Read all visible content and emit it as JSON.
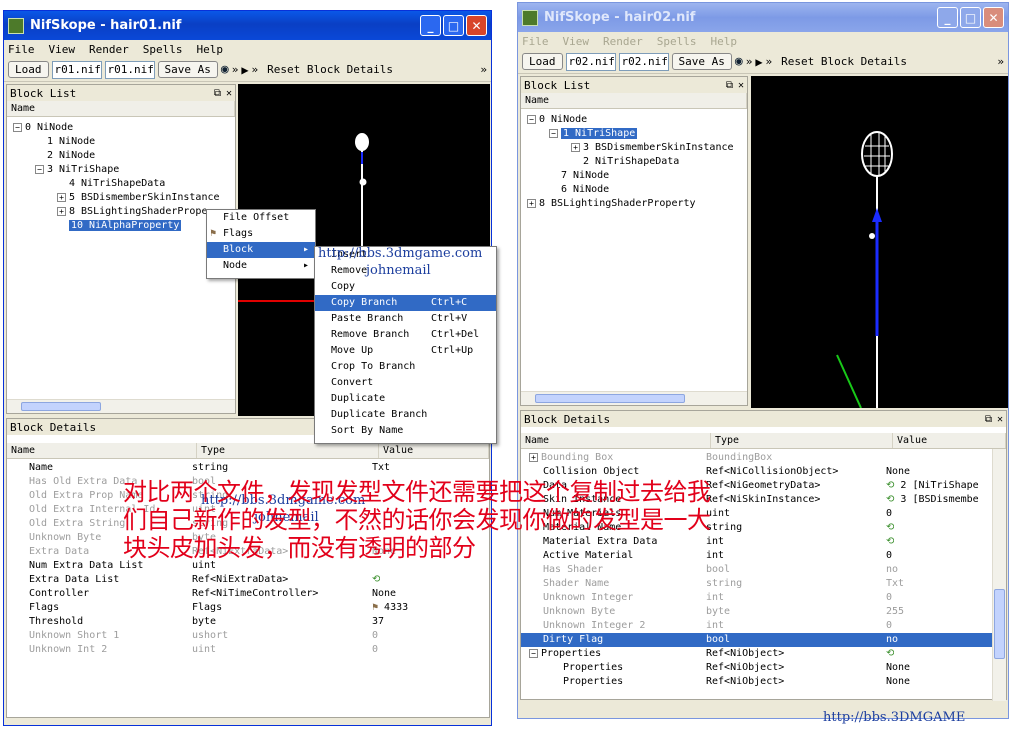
{
  "left_window": {
    "title": "NifSkope - hair01.nif",
    "menus": [
      "File",
      "View",
      "Render",
      "Spells",
      "Help"
    ],
    "toolbar": {
      "load": "Load",
      "file1": "r01.nif",
      "file2": "r01.nif",
      "save_as": "Save As",
      "reset": "Reset Block Details"
    },
    "block_list": {
      "title": "Block List",
      "col": "Name",
      "rows": [
        {
          "label": "0 NiNode",
          "expander": "−"
        },
        {
          "label": "1 NiNode"
        },
        {
          "label": "2 NiNode"
        },
        {
          "label": "3 NiTriShape",
          "expander": "−"
        },
        {
          "label": "4 NiTriShapeData"
        },
        {
          "label": "5 BSDismemberSkinInstance",
          "expander": "+"
        },
        {
          "label": "8 BSLightingShaderPrope",
          "expander": "+"
        },
        {
          "label": "10 NiAlphaProperty",
          "selected": true
        }
      ]
    },
    "context_menu": [
      {
        "label": "File Offset"
      },
      {
        "label": "Flags",
        "icon": "flag-icon"
      },
      {
        "label": "Block",
        "highlighted": true,
        "arrow": "▸"
      },
      {
        "label": "Node",
        "arrow": "▸"
      }
    ],
    "block_submenu": [
      {
        "label": "Insert"
      },
      {
        "label": "Remove"
      },
      {
        "label": "Copy"
      },
      {
        "label": "Copy Branch",
        "shortcut": "Ctrl+C",
        "highlighted": true
      },
      {
        "label": "Paste Branch",
        "shortcut": "Ctrl+V"
      },
      {
        "label": "Remove Branch",
        "shortcut": "Ctrl+Del"
      },
      {
        "label": "Move Up",
        "shortcut": "Ctrl+Up"
      },
      {
        "label": "Crop To Branch"
      },
      {
        "label": "Convert"
      },
      {
        "label": "Duplicate"
      },
      {
        "label": "Duplicate Branch"
      },
      {
        "label": "Sort By Name"
      }
    ],
    "block_details": {
      "title": "Block Details",
      "cols": [
        "Name",
        "Type",
        "Value"
      ],
      "rows": [
        {
          "name": "Name",
          "type": "string",
          "value": "Txt"
        },
        {
          "name": "Has Old Extra Data",
          "type": "bool",
          "value": "",
          "muted": true
        },
        {
          "name": "Old Extra Prop Name",
          "type": "string",
          "value": "",
          "muted": true
        },
        {
          "name": "Old Extra Internal Id",
          "type": "uint",
          "value": "",
          "muted": true
        },
        {
          "name": "Old Extra String",
          "type": "string",
          "value": "",
          "muted": true
        },
        {
          "name": "Unknown Byte",
          "type": "byte",
          "value": "",
          "muted": true
        },
        {
          "name": "Extra Data",
          "type": "Ref<NiExtraData>",
          "value": "None",
          "muted": true
        },
        {
          "name": "Num Extra Data List",
          "type": "uint",
          "value": ""
        },
        {
          "name": "Extra Data List",
          "type": "Ref<NiExtraData>",
          "value": "",
          "icon": "link-icon"
        },
        {
          "name": "Controller",
          "type": "Ref<NiTimeController>",
          "value": "None"
        },
        {
          "name": "Flags",
          "type": "Flags",
          "value": "4333",
          "icon": "flag-icon"
        },
        {
          "name": "Threshold",
          "type": "byte",
          "value": "37"
        },
        {
          "name": "Unknown Short 1",
          "type": "ushort",
          "value": "0",
          "muted": true
        },
        {
          "name": "Unknown Int 2",
          "type": "uint",
          "value": "0",
          "muted": true
        }
      ]
    },
    "watermark": {
      "url": "http://bbs.3dmgame.com",
      "user": "johnemail"
    }
  },
  "right_window": {
    "title": "NifSkope - hair02.nif",
    "menus": [
      "File",
      "View",
      "Render",
      "Spells",
      "Help"
    ],
    "toolbar": {
      "load": "Load",
      "file1": "r02.nif",
      "file2": "r02.nif",
      "save_as": "Save As",
      "reset": "Reset Block Details"
    },
    "block_list": {
      "title": "Block List",
      "col": "Name",
      "rows": [
        {
          "label": "0 NiNode",
          "expander": "−"
        },
        {
          "label": "1 NiTriShape",
          "expander": "−",
          "selected": true
        },
        {
          "label": "3 BSDismemberSkinInstance",
          "expander": "+"
        },
        {
          "label": "2 NiTriShapeData"
        },
        {
          "label": "7 NiNode"
        },
        {
          "label": "6 NiNode"
        },
        {
          "label": "8 BSLightingShaderProperty",
          "expander": "+"
        }
      ]
    },
    "block_details": {
      "title": "Block Details",
      "cols": [
        "Name",
        "Type",
        "Value"
      ],
      "rows": [
        {
          "name": "Bounding Box",
          "type": "BoundingBox",
          "value": "",
          "muted": true,
          "expander": "+"
        },
        {
          "name": "Collision Object",
          "type": "Ref<NiCollisionObject>",
          "value": "None"
        },
        {
          "name": "Data",
          "type": "Ref<NiGeometryData>",
          "value": "2 [NiTriShape",
          "icon": "link-icon"
        },
        {
          "name": "Skin Instance",
          "type": "Ref<NiSkinInstance>",
          "value": "3 [BSDismembe",
          "icon": "link-icon"
        },
        {
          "name": "Num Materials",
          "type": "uint",
          "value": "0"
        },
        {
          "name": "Material Name",
          "type": "string",
          "value": "",
          "icon": "link-icon"
        },
        {
          "name": "Material Extra Data",
          "type": "int",
          "value": "",
          "icon": "link-icon"
        },
        {
          "name": "Active Material",
          "type": "int",
          "value": "0"
        },
        {
          "name": "Has Shader",
          "type": "bool",
          "value": "no",
          "muted": true
        },
        {
          "name": "Shader Name",
          "type": "string",
          "value": "Txt",
          "muted": true
        },
        {
          "name": "Unknown Integer",
          "type": "int",
          "value": "0",
          "muted": true
        },
        {
          "name": "Unknown Byte",
          "type": "byte",
          "value": "255",
          "muted": true
        },
        {
          "name": "Unknown Integer 2",
          "type": "int",
          "value": "0",
          "muted": true
        },
        {
          "name": "Dirty Flag",
          "type": "bool",
          "value": "no",
          "selected": true
        },
        {
          "name": "Properties",
          "type": "Ref<NiObject>",
          "value": "",
          "icon": "link-icon",
          "expander": "−"
        },
        {
          "name": "Properties",
          "type": "Ref<NiObject>",
          "value": "None",
          "indent": true
        },
        {
          "name": "Properties",
          "type": "Ref<NiObject>",
          "value": "None",
          "indent": true
        }
      ]
    },
    "watermark": "http://bbs.3DMGAME"
  },
  "overlay_caption": [
    "对比两个文件，发现发型文件还需要把这个复制过去给我",
    "们自己新作的发型，不然的话你会发现你做的发型是一大",
    "块头皮加头发，而没有透明的部分"
  ],
  "colors": {
    "selection": "#316ac5",
    "caption": "#e2001a",
    "titlebar": "#0a48d8"
  }
}
